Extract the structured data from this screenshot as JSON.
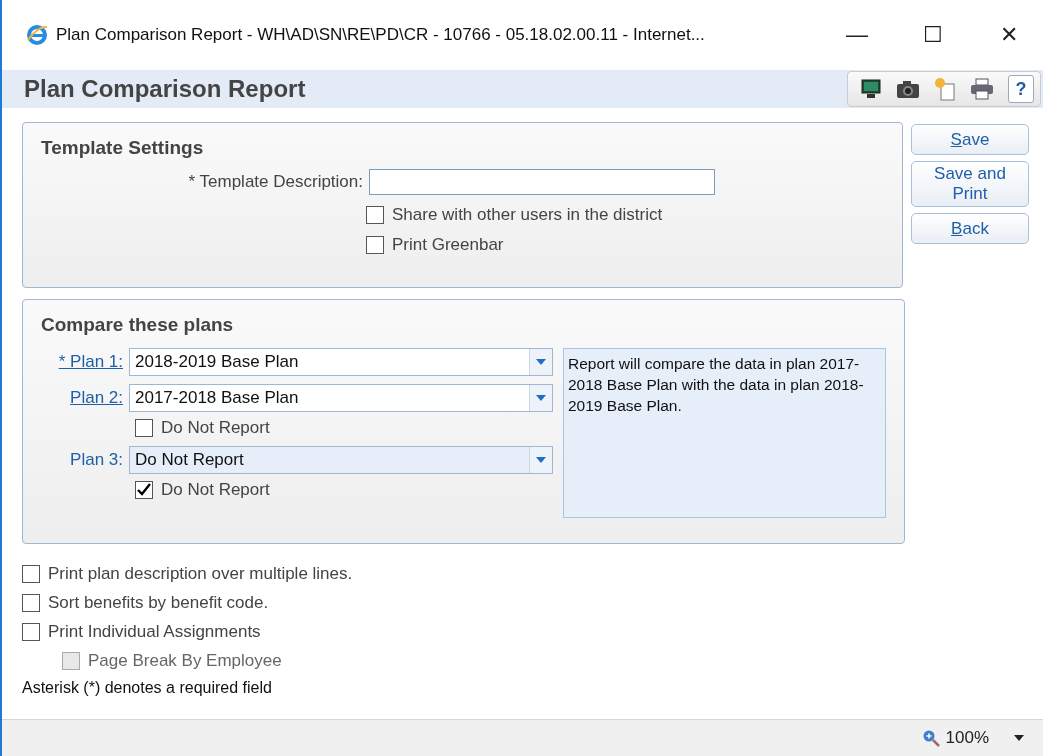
{
  "window": {
    "title": "Plan Comparison Report - WH\\AD\\SN\\RE\\PD\\CR - 10766 - 05.18.02.00.11 - Internet...",
    "controls": [
      "—",
      "☐",
      "✕"
    ]
  },
  "header": {
    "title": "Plan Comparison Report",
    "help_label": "?"
  },
  "template_settings": {
    "title": "Template Settings",
    "description_label": "* Template Description:",
    "options": [
      {
        "label": "Share with other users in the district",
        "checked": false
      },
      {
        "label": "Print Greenbar",
        "checked": false
      }
    ]
  },
  "actions": [
    {
      "label": "Save",
      "access_key": true
    },
    {
      "label": "Save and Print",
      "access_key": false
    },
    {
      "label": "Back",
      "access_key": true
    }
  ],
  "compare": {
    "title": "Compare these plans",
    "plans": [
      {
        "label": "* Plan 1:",
        "link": true,
        "value": "2018-2019 Base Plan",
        "shaded": false
      },
      {
        "label": "Plan 2:",
        "link": true,
        "value": "2017-2018 Base Plan",
        "shaded": false,
        "option": {
          "label": "Do Not Report",
          "checked": false
        }
      },
      {
        "label": "Plan 3:",
        "link": false,
        "value": "Do Not Report",
        "shaded": true,
        "option": {
          "label": "Do Not Report",
          "checked": true
        }
      }
    ],
    "note": "Report will compare the data in plan 2017-2018 Base Plan with the data in plan 2018-2019 Base Plan."
  },
  "options": [
    {
      "label": "Print plan description over multiple lines.",
      "checked": false,
      "disabled": false,
      "indented": false
    },
    {
      "label": "Sort benefits by benefit code.",
      "checked": false,
      "disabled": false,
      "indented": false
    },
    {
      "label": "Print Individual Assignments",
      "checked": false,
      "disabled": false,
      "indented": false
    },
    {
      "label": "Page Break By Employee",
      "checked": false,
      "disabled": true,
      "indented": true
    }
  ],
  "footnote": "Asterisk (*) denotes a required field",
  "status_bar": {
    "zoom": "100%"
  }
}
